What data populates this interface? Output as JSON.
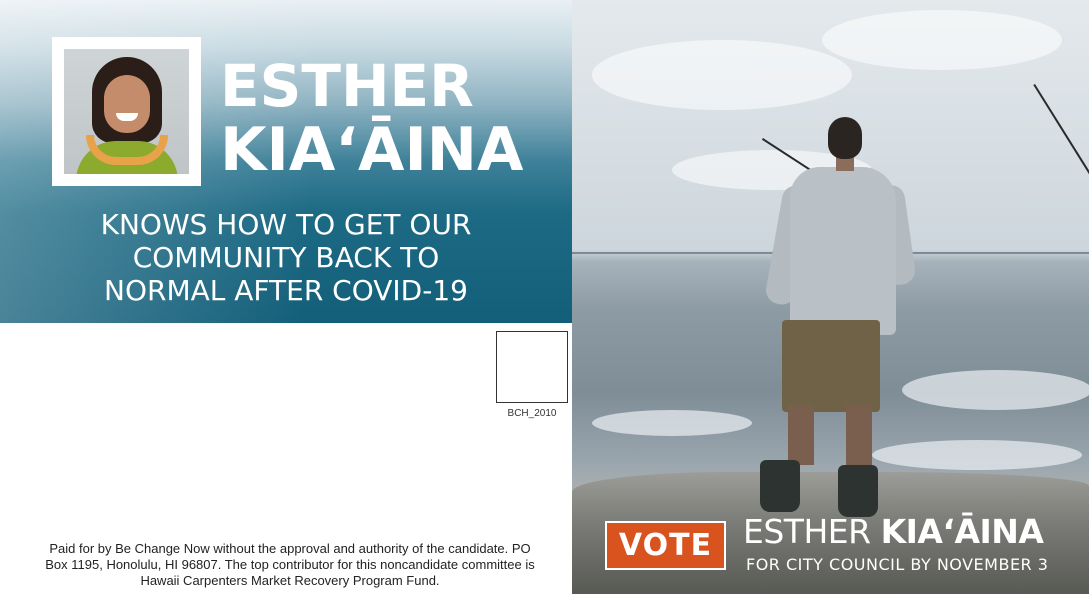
{
  "candidate": {
    "name_line1": "ESTHER",
    "name_line2": "KIA‘ĀINA"
  },
  "tagline": "KNOWS HOW TO GET OUR\nCOMMUNITY BACK TO\nNORMAL AFTER COVID-19",
  "mailing": {
    "code": "BCH_2010"
  },
  "disclaimer": "Paid for by Be Change Now without the approval and authority of the candidate. PO Box 1195, Honolulu, HI 96807. The top contributor for this noncandidate committee is Hawaii Carpenters Market Recovery Program Fund.",
  "vote": {
    "badge": "VOTE",
    "first_name": "ESTHER",
    "last_name": "KIA‘ĀINA",
    "subline": "FOR CITY COUNCIL BY NOVEMBER 3"
  },
  "colors": {
    "banner_teal": "#135f7a",
    "vote_orange": "#d9531e"
  }
}
